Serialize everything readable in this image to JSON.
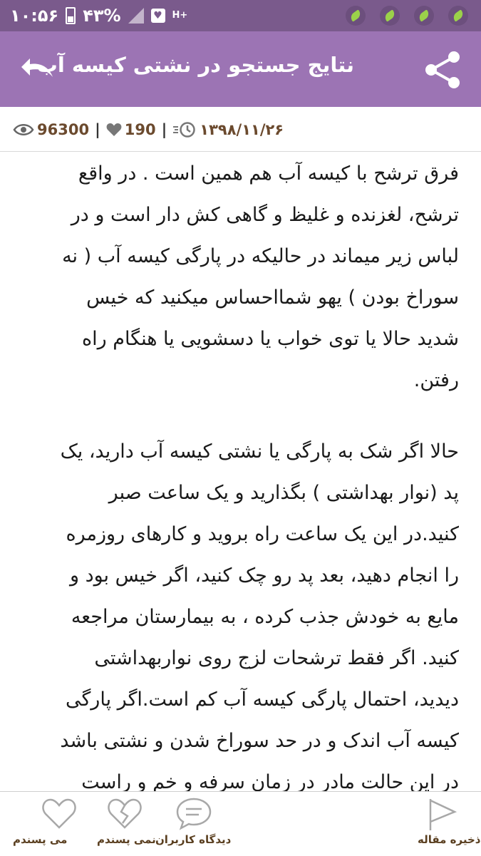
{
  "status_bar": {
    "time": "۱۰:۵۶",
    "battery": "۴۳%",
    "network": "H+"
  },
  "header": {
    "title": "نتایج جستجو در نشتی کیسه آب",
    "background": "#9c74b4"
  },
  "meta": {
    "views": "96300",
    "likes": "190",
    "date": "۱۳۹۸/۱۱/۲۶",
    "separator": "|"
  },
  "article": {
    "paragraphs": [
      [
        "فرق ترشح با کیسه آب هم همین است . در واقع",
        "ترشح،  لغزنده و غلیظ  و گاهی کش دار است و در",
        "لباس زیر میماند در حالیکه در پارگی کیسه آب ( نه",
        "سوراخ بودن ) یهو شمااحساس میکنید که خیس",
        "شدید حالا یا توی خواب یا دسشویی یا هنگام راه",
        "رفتن."
      ],
      [
        "حالا  اگر شک به پارگی یا نشتی کیسه آب دارید، یک",
        "پد (نوار بهداشتی )  بگذارید و یک ساعت صبر",
        "کنید.در این یک ساعت راه بروید و کارهای روزمره",
        "را انجام دهید، بعد پد رو چک کنید، اگر خیس بود و",
        "مایع به خودش جذب کرده ، به بیمارستان مراجعه",
        "کنید. اگر فقط ترشحات لزج روی نواربهداشتی",
        "دیدید، احتمال پارگی کیسه آب کم است.اگر پارگی",
        "کیسه آب اندک و در حد سوراخ شدن و نشتی باشد",
        "در این حالت مادر در زمان سرفه و خم و راست"
      ]
    ]
  },
  "bottom_bar": {
    "like_label": "می پسندم",
    "dislike_label": "نمی پسندم",
    "comments_label": "دیدگاه کاربران",
    "save_label": "ذخیره مقاله"
  },
  "colors": {
    "status_bar": "#7a5a8c",
    "accent": "#9c74b4",
    "label_brown": "#5a3f20",
    "meta_brown": "#6b4a2e"
  }
}
